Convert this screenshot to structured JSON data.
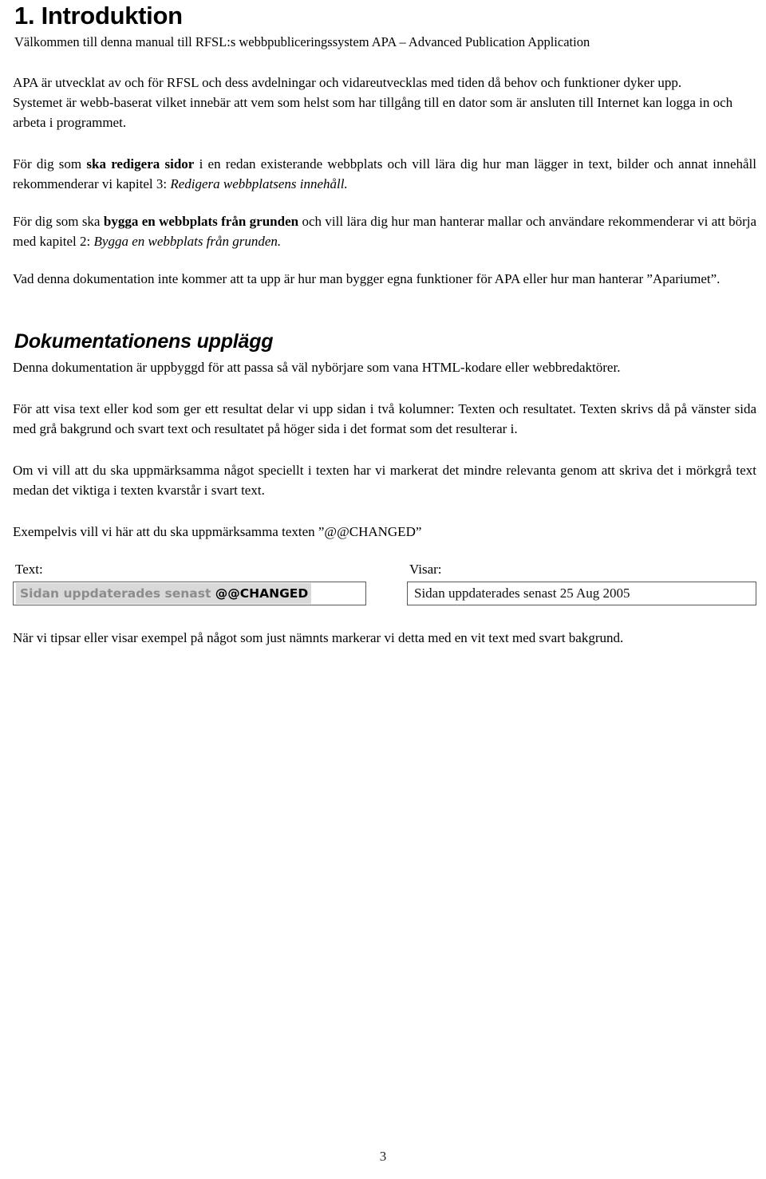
{
  "document": {
    "heading": "1. Introduktion",
    "intro_line": "Välkommen till denna manual till RFSL:s webbpubliceringssystem APA – Advanced Publication Application",
    "paragraphs": {
      "apa_developed": "APA är utvecklat av och för RFSL och dess avdelningar och vidareutvecklas med tiden då behov och funktioner dyker upp.",
      "system_webbased": "Systemet är webb-baserat vilket innebär att vem som helst som har tillgång till en dator som är ansluten till Internet kan logga in och arbeta i programmet.",
      "edit_pages_pre": "För dig som ",
      "edit_pages_bold": "ska redigera sidor",
      "edit_pages_mid": " i en redan existerande webbplats och vill lära dig hur man lägger in text, bilder och annat innehåll rekommenderar vi kapitel 3: ",
      "edit_pages_italic": "Redigera webbplatsens innehåll.",
      "build_site_pre": "För dig som ska ",
      "build_site_bold": "bygga en webbplats från grunden",
      "build_site_mid": " och vill lära dig hur man hanterar mallar och användare rekommenderar vi att börja med kapitel 2: ",
      "build_site_italic": "Bygga en webbplats från grunden.",
      "not_covered": "Vad denna dokumentation inte kommer att ta upp är hur man bygger egna funktioner för APA eller hur man hanterar ”Apariumet”."
    }
  },
  "section_layout": {
    "heading": "Dokumentationens upplägg",
    "paragraphs": {
      "built_for": "Denna dokumentation är uppbyggd för att passa så väl nybörjare som vana HTML-kodare eller webbredaktörer.",
      "two_columns": "För att visa text eller kod som ger ett resultat delar vi upp sidan i två kolumner: Texten och resultatet. Texten skrivs då på vänster sida med grå bakgrund och svart text och resultatet på höger sida i det format som det resulterar i.",
      "dark_gray": "Om vi vill att du ska uppmärksamma något speciellt i texten har vi markerat det mindre relevanta genom att skriva det i mörkgrå text medan det viktiga i texten kvarstår i svart text.",
      "example_intro": "Exempelvis vill vi här att du ska uppmärksamma texten ”@@CHANGED”",
      "white_on_black": "När vi tipsar eller visar exempel på något som just nämnts markerar vi detta med en vit text med svart bakgrund."
    }
  },
  "example": {
    "label_text": "Text:",
    "label_visar": "Visar:",
    "code_dim": "Sidan uppdaterades senast ",
    "code_highlight": "@@CHANGED",
    "rendered": "Sidan uppdaterades senast 25 Aug 2005"
  },
  "footer": {
    "page_number": "3"
  },
  "colors": {
    "code_background": "#d9d9d9",
    "code_dim_text": "#8c8c8c",
    "box_border": "#5a5a5a",
    "text": "#000000"
  }
}
